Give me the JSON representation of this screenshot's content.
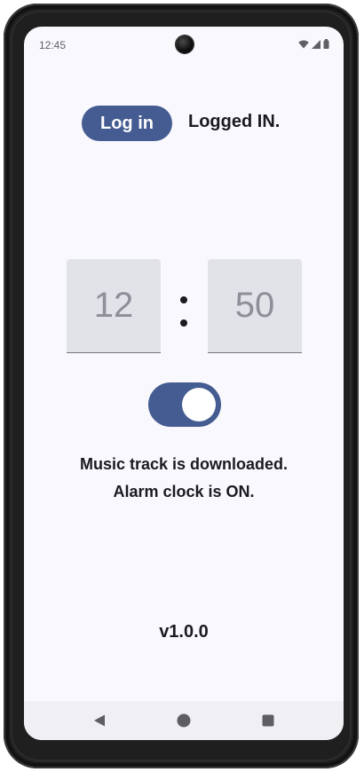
{
  "status_bar": {
    "time": "12:45",
    "icons": [
      "wifi-icon",
      "signal-icon",
      "battery-icon"
    ]
  },
  "login": {
    "button_label": "Log in",
    "status_text": "Logged IN."
  },
  "alarm_time": {
    "hour": "12",
    "separator": ":",
    "minute": "50"
  },
  "alarm_toggle": {
    "state": "on"
  },
  "messages": {
    "download_status": "Music track is downloaded.",
    "alarm_status": "Alarm clock is ON."
  },
  "version": "v1.0.0",
  "navigation": {
    "buttons": [
      "back-icon",
      "home-icon",
      "recents-icon"
    ]
  },
  "colors": {
    "accent": "#445c91",
    "background": "#f9f8fd",
    "field_background": "#e2e2e9",
    "field_text": "#8e9099",
    "text": "#1b1b1f"
  }
}
